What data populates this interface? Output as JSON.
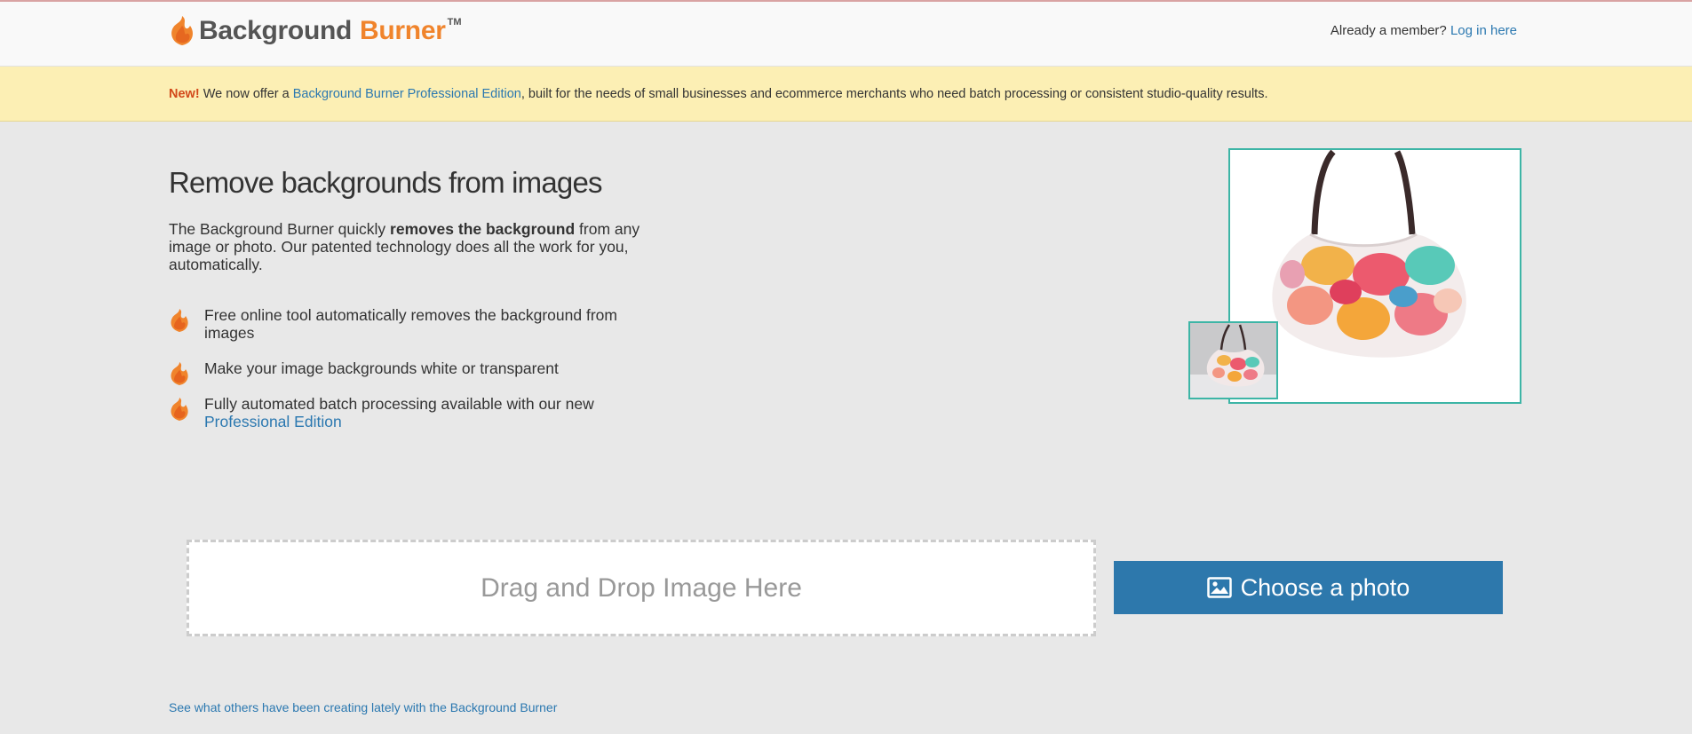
{
  "header": {
    "logo_word1": "Background",
    "logo_word2": "Burner",
    "logo_tm": "TM",
    "member_text": "Already a member?",
    "login_link": "Log in here"
  },
  "banner": {
    "new_label": "New!",
    "text_before": "We now offer a",
    "link": "Background Burner Professional Edition",
    "text_after": ", built for the needs of small businesses and ecommerce merchants who need batch processing or consistent studio-quality results."
  },
  "main": {
    "title": "Remove backgrounds from images",
    "intro_before": "The Background Burner quickly",
    "intro_bold": "removes the background",
    "intro_after": "from any image or photo. Our patented technology does all the work for you, automatically.",
    "features": [
      {
        "text": "Free online tool automatically removes the background from images"
      },
      {
        "text": "Make your image backgrounds white or transparent"
      },
      {
        "text": "Fully automated batch processing available with our new",
        "link": "Professional Edition"
      }
    ]
  },
  "upload": {
    "dropzone_label": "Drag and Drop Image Here",
    "choose_label": "Choose a photo"
  },
  "footer": {
    "see_others": "See what others have been creating lately with the Background Burner"
  },
  "colors": {
    "brand_orange": "#f0842c",
    "link_blue": "#2b78b0",
    "button_blue": "#2d78ac",
    "frame_teal": "#3db5a6",
    "banner_yellow": "#fcefb4"
  },
  "icons": {
    "logo": "flame-icon",
    "bullet": "flame-bullet-icon",
    "choose": "image-icon"
  }
}
